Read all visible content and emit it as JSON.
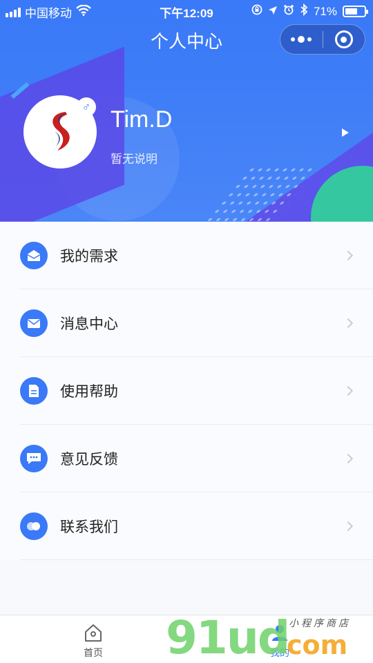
{
  "status_bar": {
    "carrier": "中国移动",
    "time": "下午12:09",
    "battery_percent": "71%",
    "battery_level": 0.71
  },
  "nav": {
    "title": "个人中心"
  },
  "profile": {
    "name": "Tim.D",
    "bio": "暂无说明",
    "gender_symbol": "♂"
  },
  "menu": {
    "items": [
      {
        "label": "我的需求",
        "icon": "envelope-open-icon"
      },
      {
        "label": "消息中心",
        "icon": "envelope-icon"
      },
      {
        "label": "使用帮助",
        "icon": "document-icon"
      },
      {
        "label": "意见反馈",
        "icon": "chat-bubble-icon"
      },
      {
        "label": "联系我们",
        "icon": "contact-circles-icon"
      }
    ]
  },
  "tabbar": {
    "home_label": "首页",
    "mine_label": "我的",
    "active": "mine"
  },
  "watermark": {
    "main": "91ud",
    "suffix": "com",
    "sub": "小程序商店"
  },
  "colors": {
    "primary": "#3a79f7",
    "accent_green": "#35c8a0",
    "accent_purple": "#5d4ee9"
  }
}
